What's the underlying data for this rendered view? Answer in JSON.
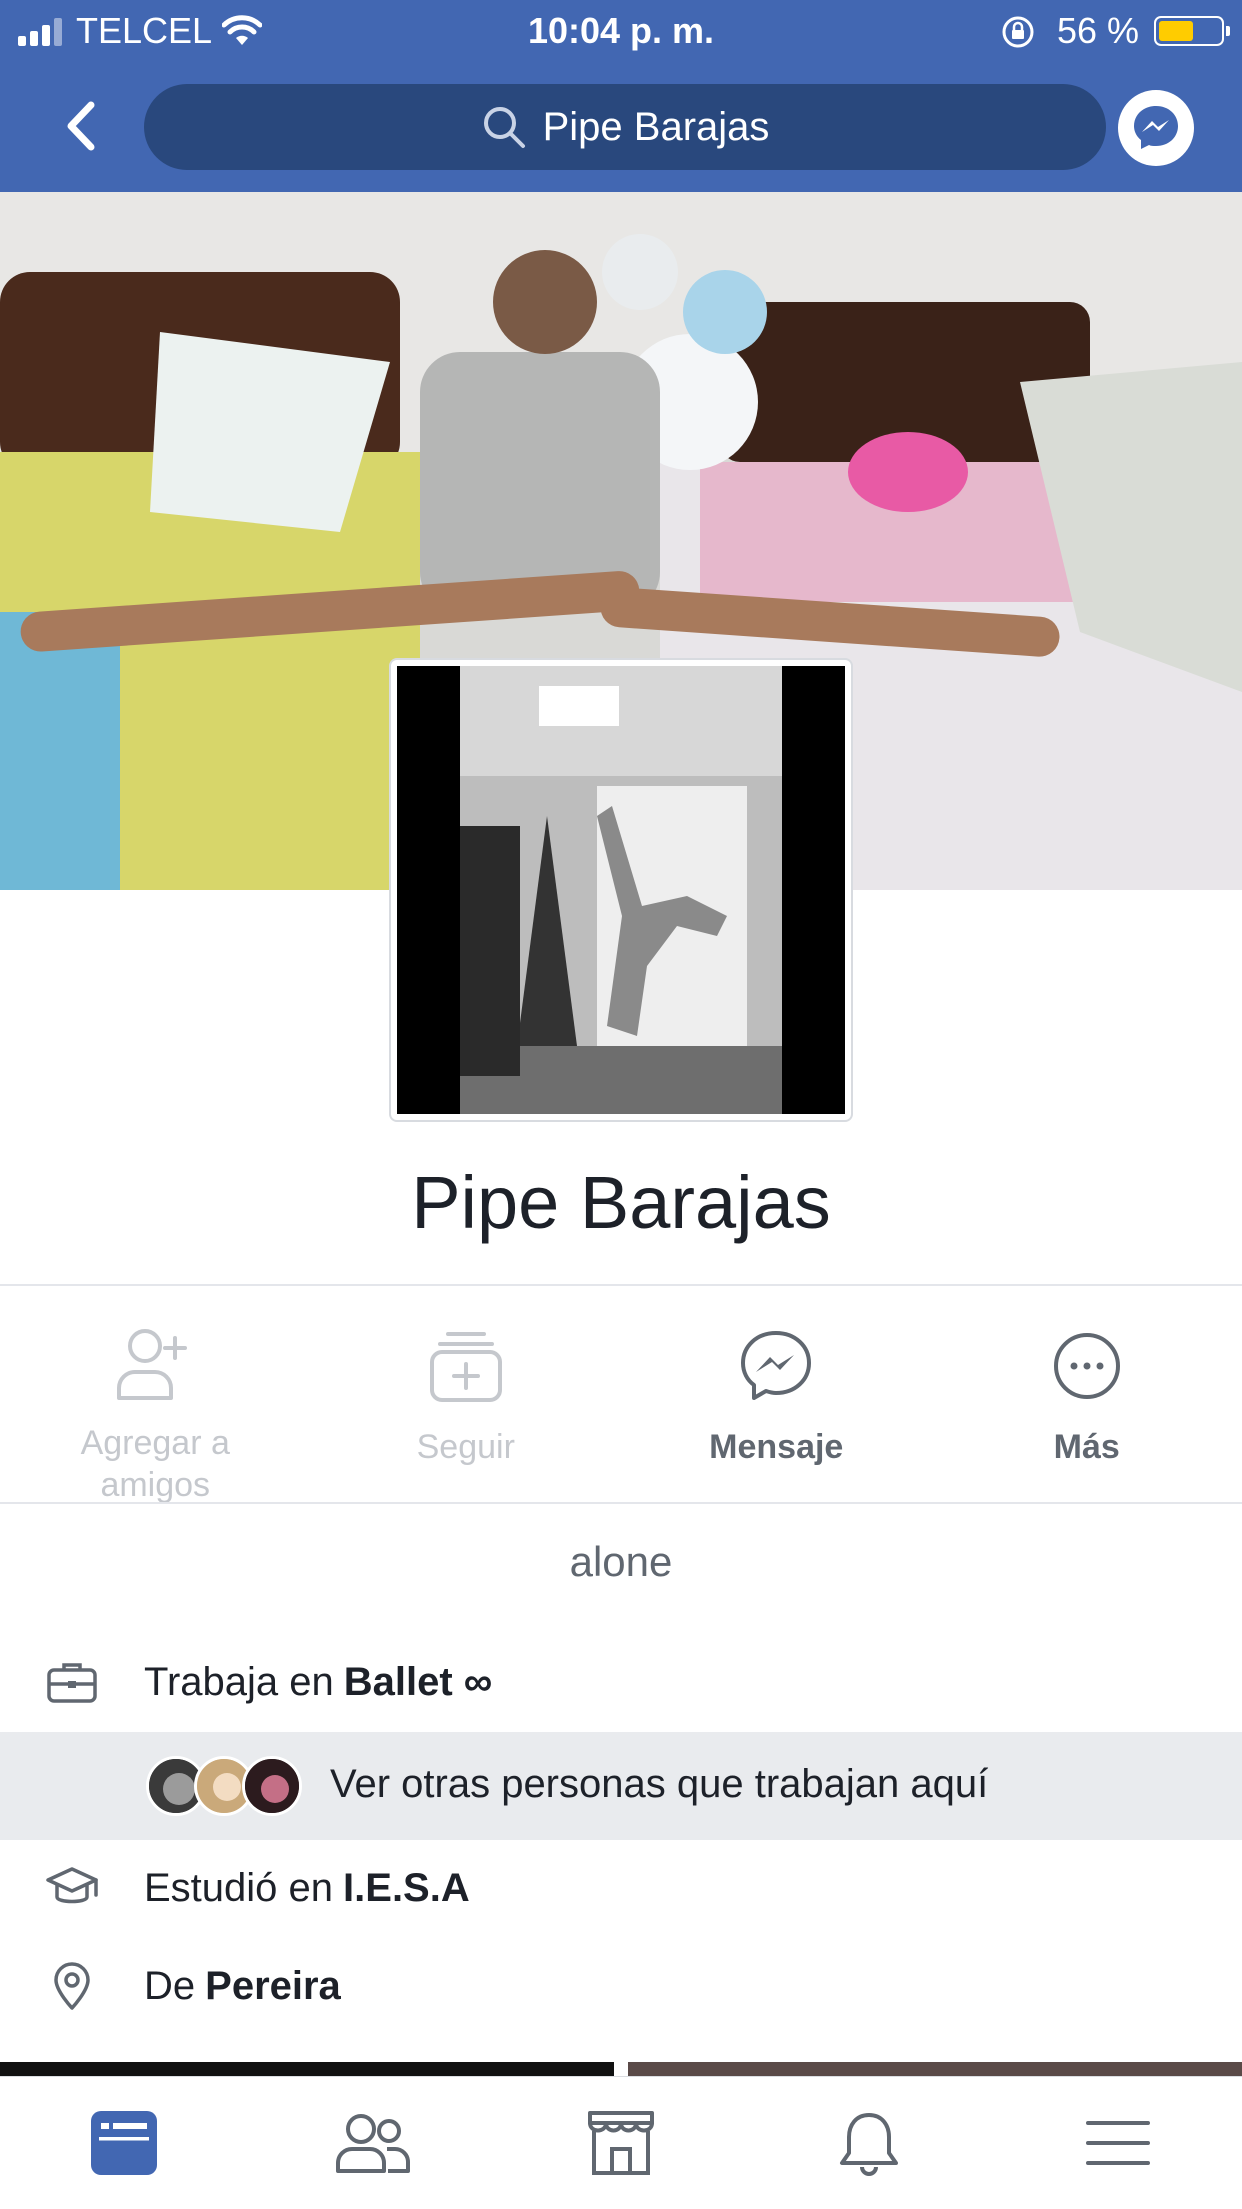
{
  "status_bar": {
    "carrier": "TELCEL",
    "time": "10:04 p. m.",
    "battery_percent": "56 %",
    "battery_level": 0.56,
    "battery_color": "#ffcc00"
  },
  "nav": {
    "search_text": "Pipe Barajas",
    "bar_color": "#4267b2"
  },
  "profile": {
    "name": "Pipe Barajas",
    "bio": "alone"
  },
  "actions": [
    {
      "label": "Agregar a amigos",
      "icon": "add-friend-icon",
      "enabled": false
    },
    {
      "label": "Seguir",
      "icon": "follow-icon",
      "enabled": false
    },
    {
      "label": "Mensaje",
      "icon": "messenger-icon",
      "enabled": true
    },
    {
      "label": "Más",
      "icon": "more-icon",
      "enabled": true
    }
  ],
  "intro": {
    "work": {
      "prefix": "Trabaja en",
      "place": "Ballet ∞"
    },
    "coworkers_link": "Ver otras personas que trabajan aquí",
    "education": {
      "prefix": "Estudió en",
      "place": "I.E.S.A"
    },
    "hometown": {
      "prefix": "De",
      "place": "Pereira"
    }
  },
  "tabs": [
    {
      "icon": "news-feed-icon",
      "active": true
    },
    {
      "icon": "friends-icon",
      "active": false
    },
    {
      "icon": "marketplace-icon",
      "active": false
    },
    {
      "icon": "notifications-icon",
      "active": false
    },
    {
      "icon": "menu-icon",
      "active": false
    }
  ],
  "colors": {
    "accent": "#4267b2",
    "active_tab": "#4267b2",
    "inactive_icon": "#606770"
  }
}
